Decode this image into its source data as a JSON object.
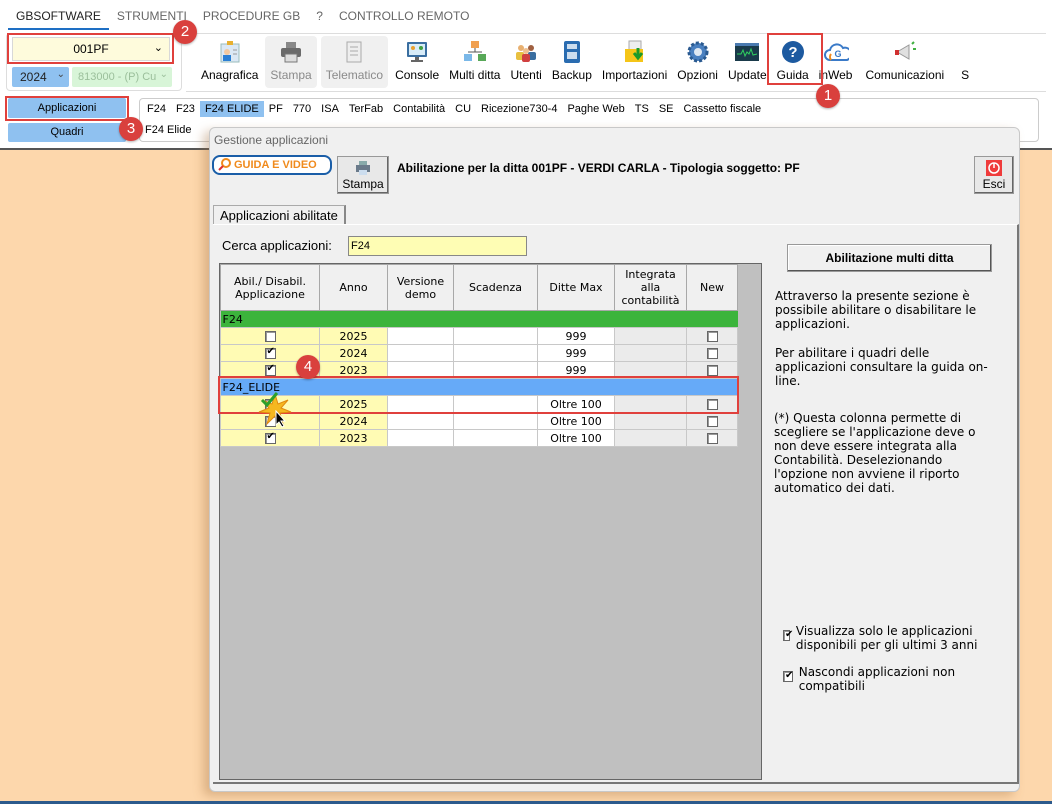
{
  "menu": [
    "GBSOFTWARE",
    "STRUMENTI",
    "PROCEDURE GB",
    "?",
    "CONTROLLO REMOTO"
  ],
  "company": {
    "code": "001PF",
    "year": "2024",
    "activity": "813000 - (P) Cu"
  },
  "toolbar": [
    {
      "label": "Anagrafica",
      "icon": "id-card-icon",
      "enabled": true
    },
    {
      "label": "Stampa",
      "icon": "printer-icon",
      "enabled": false
    },
    {
      "label": "Telematico",
      "icon": "document-icon",
      "enabled": false
    },
    {
      "label": "Console",
      "icon": "monitor-icon",
      "enabled": true
    },
    {
      "label": "Multi ditta",
      "icon": "org-chart-icon",
      "enabled": true
    },
    {
      "label": "Utenti",
      "icon": "users-icon",
      "enabled": true
    },
    {
      "label": "Backup",
      "icon": "backup-icon",
      "enabled": true
    },
    {
      "label": "Importazioni",
      "icon": "import-icon",
      "enabled": true
    },
    {
      "label": "Opzioni",
      "icon": "gear-icon",
      "enabled": true
    },
    {
      "label": "Update",
      "icon": "update-monitor-icon",
      "enabled": true
    },
    {
      "label": "Guida",
      "icon": "help-icon",
      "enabled": true
    },
    {
      "label": "inWeb",
      "icon": "cloud-icon",
      "enabled": true
    },
    {
      "label": "Comunicazioni",
      "icon": "megaphone-icon",
      "enabled": true
    },
    {
      "label": "S",
      "icon": "",
      "enabled": true
    }
  ],
  "side_buttons": {
    "applicazioni": "Applicazioni",
    "quadri": "Quadri"
  },
  "app_tabs": [
    "F24",
    "F23",
    "F24 ELIDE",
    "PF",
    "770",
    "ISA",
    "TerFab",
    "Contabilità",
    "CU",
    "Ricezione730-4",
    "Paghe Web",
    "TS",
    "SE",
    "Cassetto fiscale"
  ],
  "active_app_tab": "F24 ELIDE",
  "sub_tab": "F24 Elide",
  "badges": [
    "1",
    "2",
    "3",
    "4"
  ],
  "dialog": {
    "title": "Gestione applicazioni",
    "guida_label": "GUIDA E VIDEO",
    "stampa_label": "Stampa",
    "heading": "Abilitazione per la ditta 001PF -  VERDI CARLA - Tipologia soggetto: PF",
    "esci_label": "Esci",
    "tab_label": "Applicazioni abilitate",
    "search_label": "Cerca applicazioni:",
    "search_value": "F24",
    "columns": [
      "Abil./ Disabil. Applicazione",
      "Anno",
      "Versione demo",
      "Scadenza",
      "Ditte Max",
      "Integrata alla contabilità",
      "New"
    ],
    "groups": [
      {
        "name": "F24",
        "color": "#3cb43c",
        "rows": [
          {
            "enabled": false,
            "anno": "2025",
            "demo": "",
            "scadenza": "",
            "ditte_max": "999",
            "new": false
          },
          {
            "enabled": true,
            "anno": "2024",
            "demo": "",
            "scadenza": "",
            "ditte_max": "999",
            "new": false
          },
          {
            "enabled": true,
            "anno": "2023",
            "demo": "",
            "scadenza": "",
            "ditte_max": "999",
            "new": false
          }
        ]
      },
      {
        "name": "F24_ELIDE",
        "color": "#66aaf8",
        "rows": [
          {
            "enabled": true,
            "anno": "2025",
            "demo": "",
            "scadenza": "",
            "ditte_max": "Oltre 100",
            "new": false
          },
          {
            "enabled": true,
            "anno": "2024",
            "demo": "",
            "scadenza": "",
            "ditte_max": "Oltre 100",
            "new": false
          },
          {
            "enabled": true,
            "anno": "2023",
            "demo": "",
            "scadenza": "",
            "ditte_max": "Oltre 100",
            "new": false
          }
        ]
      }
    ],
    "multi_ditta_label": "Abilitazione multi ditta",
    "info1": "Attraverso la presente sezione è possibile abilitare o disabilitare le applicazioni.",
    "info2": "Per abilitare i quadri delle applicazioni consultare la guida on-line.",
    "info3": "(*) Questa colonna permette di scegliere se l'applicazione deve o non deve essere integrata alla Contabilità. Deselezionando l'opzione non avviene il riporto automatico dei dati.",
    "opt1": {
      "label": "Visualizza solo le applicazioni disponibili per gli ultimi 3 anni",
      "checked": true
    },
    "opt2": {
      "label": "Nascondi applicazioni non compatibili",
      "checked": true
    }
  }
}
